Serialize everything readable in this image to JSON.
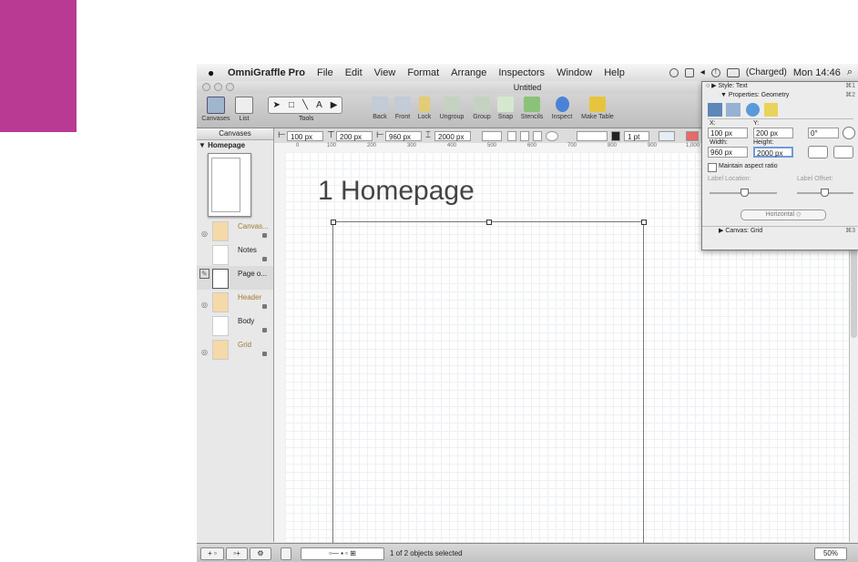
{
  "menubar": {
    "app": "OmniGraffle Pro",
    "items": [
      "File",
      "Edit",
      "View",
      "Format",
      "Arrange",
      "Inspectors",
      "Window",
      "Help"
    ],
    "battery": "(Charged)",
    "clock": "Mon 14:46"
  },
  "window": {
    "title": "Untitled"
  },
  "toolbar": {
    "canvases": "Canvases",
    "list": "List",
    "tools": "Tools",
    "back": "Back",
    "front": "Front",
    "lock": "Lock",
    "ungroup": "Ungroup",
    "group": "Group",
    "snap": "Snap",
    "stencils": "Stencils",
    "inspect": "Inspect",
    "make_table": "Make Table"
  },
  "sidebar": {
    "header": "Canvases",
    "canvas_name": "▼ Homepage",
    "layers": [
      {
        "label": "Canvas...",
        "color": "#f5d9a8"
      },
      {
        "label": "Notes",
        "color": "#ffffff"
      },
      {
        "label": "Page o...",
        "color": "#ffffff"
      },
      {
        "label": "Header",
        "color": "#f5d9a8"
      },
      {
        "label": "Body",
        "color": "#ffffff"
      },
      {
        "label": "Grid",
        "color": "#f5d9a8"
      }
    ]
  },
  "options": {
    "x": "100 px",
    "y": "200 px",
    "w": "960 px",
    "h": "2000 px",
    "stroke": "1 pt"
  },
  "canvas": {
    "title": "1 Homepage"
  },
  "status": {
    "text": "1 of 2 objects selected",
    "zoom": "50%"
  },
  "inspector": {
    "style_row": "Style: Text",
    "style_key": "⌘1",
    "props_row": "Properties: Geometry",
    "props_key": "⌘2",
    "x_label": "X:",
    "y_label": "Y:",
    "x_value": "100 px",
    "y_value": "200 px",
    "rotation": "0°",
    "width_label": "Width:",
    "height_label": "Height:",
    "width_value": "960 px",
    "height_value": "2000 px",
    "aspect": "Maintain aspect ratio",
    "label_location": "Label Location:",
    "label_offset": "Label Offset:",
    "orientation": "Horizontal",
    "canvas_row": "Canvas: Grid",
    "canvas_key": "⌘3"
  },
  "colors": {
    "accent_pink": "#b83a93",
    "layer_gold": "#f5d9a8"
  }
}
